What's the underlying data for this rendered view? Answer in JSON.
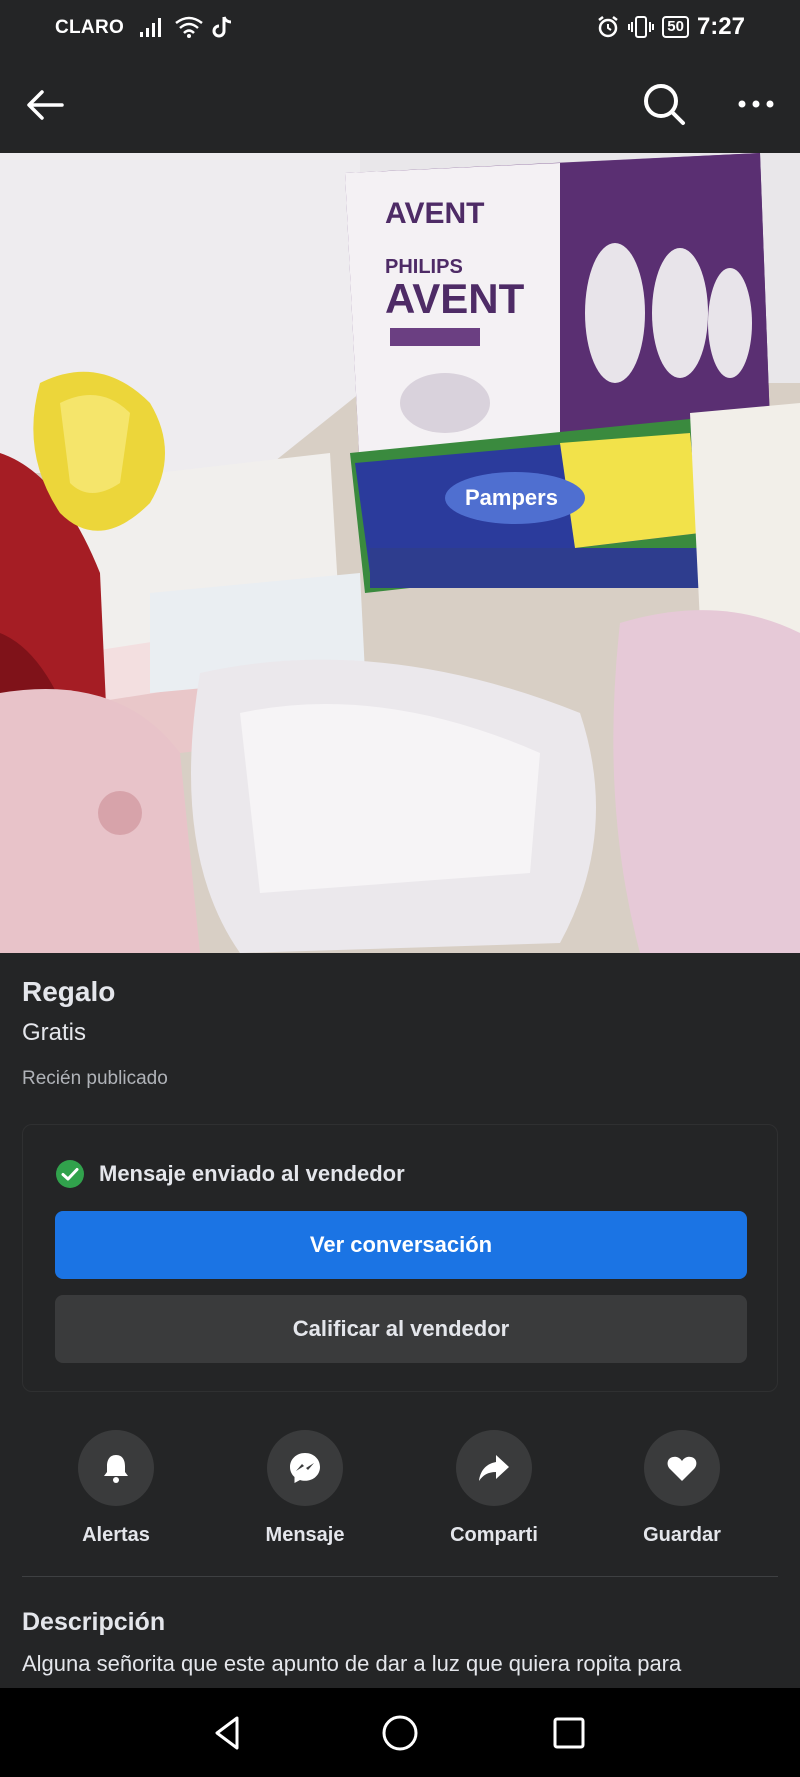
{
  "status_bar": {
    "carrier": "CLARO",
    "battery": "50",
    "time": "7:27",
    "icons": [
      "signal-icon",
      "wifi-icon",
      "tiktok-icon",
      "alarm-icon",
      "vibrate-icon",
      "battery-icon"
    ]
  },
  "app_bar": {
    "icons": [
      "back-arrow-icon",
      "search-icon",
      "more-icon"
    ]
  },
  "listing": {
    "photo_subject": "",
    "title": "Regalo",
    "price": "Gratis",
    "posted": "Recién publicado"
  },
  "message_card": {
    "status": "Mensaje enviado al vendedor",
    "primary_button": "Ver conversación",
    "secondary_button": "Calificar al vendedor",
    "colors": {
      "primary": "#1b74e4",
      "success": "#31a24c"
    }
  },
  "actions": [
    {
      "label": "Alertas",
      "icon": "bell-icon"
    },
    {
      "label": "Mensaje",
      "icon": "messenger-icon"
    },
    {
      "label": "Comparti",
      "icon": "share-icon"
    },
    {
      "label": "Guardar",
      "icon": "heart-icon"
    }
  ],
  "description": {
    "heading": "Descripción",
    "text": "Alguna señorita que este apunto de dar a luz  que quiera ropita para"
  },
  "photo_text": {
    "brand_top": "AVENT",
    "brand_philips": "PHILIPS",
    "brand_main": "AVENT",
    "wipes": "Pampers"
  },
  "nav_bar": {
    "icons": [
      "back-triangle-icon",
      "home-circle-icon",
      "recents-square-icon"
    ]
  }
}
